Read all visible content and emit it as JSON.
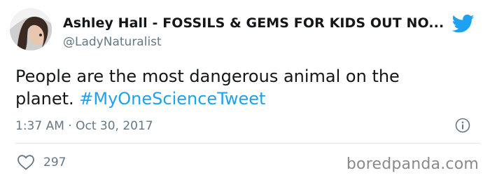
{
  "author": {
    "display_name": "Ashley Hall - FOSSILS & GEMS FOR KIDS OUT NO...",
    "handle": "@LadyNaturalist"
  },
  "tweet": {
    "text_before": "People are the most dangerous animal on the planet. ",
    "hashtag": "#MyOneScienceTweet",
    "timestamp": "1:37 AM · Oct 30, 2017"
  },
  "stats": {
    "likes": "297"
  },
  "watermark": "boredpanda.com",
  "colors": {
    "accent": "#1da1f2",
    "text": "#14171a",
    "muted": "#657786"
  },
  "icons": {
    "brand": "twitter-bird-icon",
    "info": "info-icon",
    "like": "heart-icon"
  }
}
